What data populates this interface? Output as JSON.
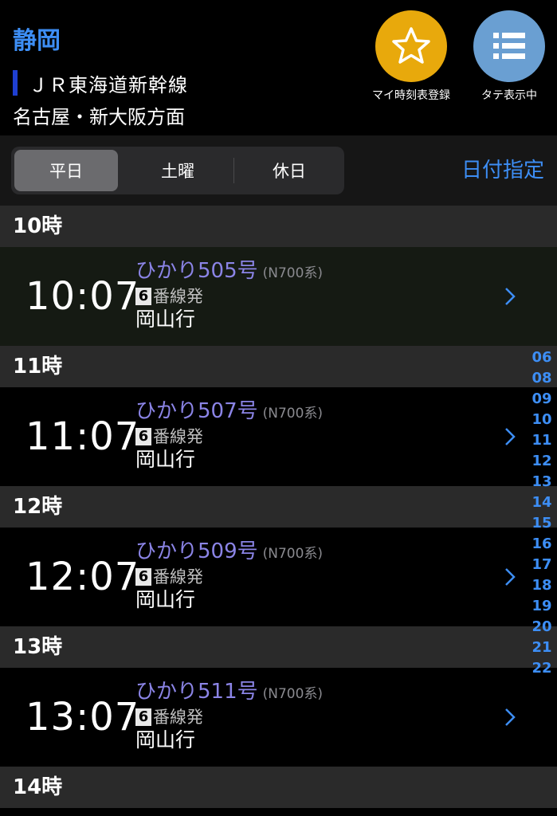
{
  "header": {
    "station": "静岡",
    "line": "ＪＲ東海道新幹線",
    "direction": "名古屋・新大阪方面",
    "fav_label": "マイ時刻表登録",
    "list_label": "タテ表示中"
  },
  "tabs": {
    "items": [
      "平日",
      "土曜",
      "休日"
    ],
    "active": "平日",
    "date_label": "日付指定"
  },
  "hours": [
    {
      "label": "10時",
      "train": {
        "time": "10:07",
        "name": "ひかり505号",
        "type": "(N700系)",
        "platform": "6",
        "platform_suffix": "番線発",
        "destination": "岡山行"
      }
    },
    {
      "label": "11時",
      "train": {
        "time": "11:07",
        "name": "ひかり507号",
        "type": "(N700系)",
        "platform": "6",
        "platform_suffix": "番線発",
        "destination": "岡山行"
      }
    },
    {
      "label": "12時",
      "train": {
        "time": "12:07",
        "name": "ひかり509号",
        "type": "(N700系)",
        "platform": "6",
        "platform_suffix": "番線発",
        "destination": "岡山行"
      }
    },
    {
      "label": "13時",
      "train": {
        "time": "13:07",
        "name": "ひかり511号",
        "type": "(N700系)",
        "platform": "6",
        "platform_suffix": "番線発",
        "destination": "岡山行"
      }
    },
    {
      "label": "14時"
    }
  ],
  "hour_index": [
    "06",
    "08",
    "09",
    "10",
    "11",
    "12",
    "13",
    "14",
    "15",
    "16",
    "17",
    "18",
    "19",
    "20",
    "21",
    "22"
  ],
  "colors": {
    "accent": "#3d8ef5",
    "train_name": "#8b84e6",
    "fav": "#e8a90c",
    "list": "#6a9fd2"
  }
}
